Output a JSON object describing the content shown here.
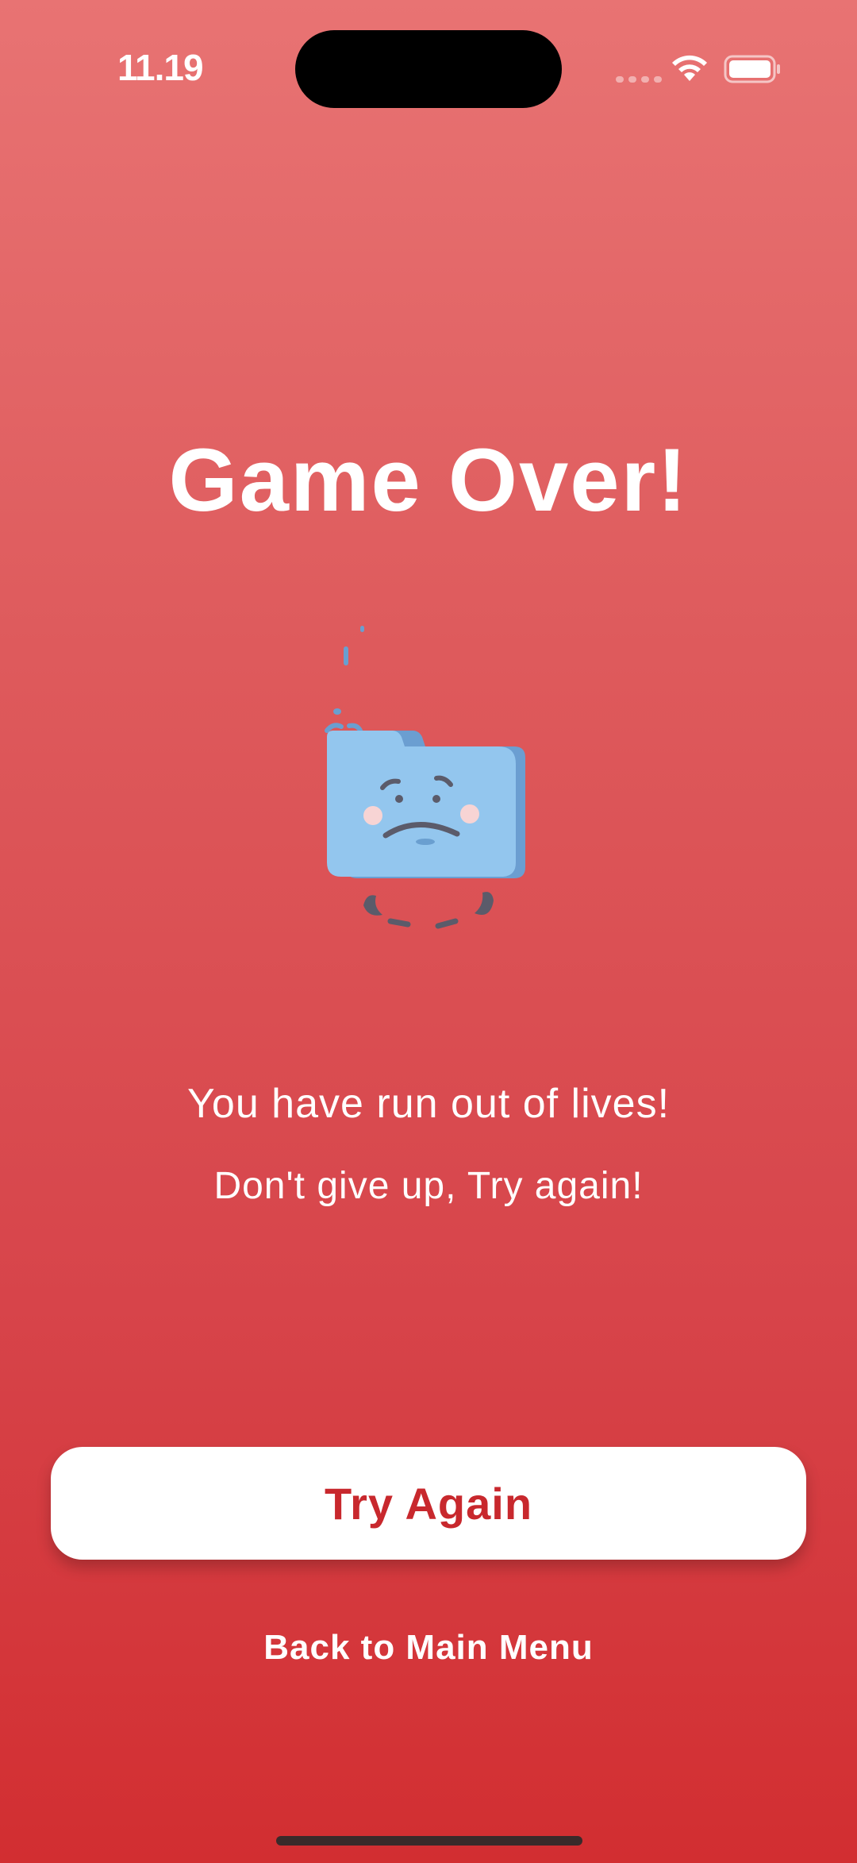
{
  "status_bar": {
    "time": "11.19",
    "icons": [
      "cellular-signal-icon",
      "wifi-icon",
      "battery-icon"
    ]
  },
  "screen": {
    "title": "Game Over!",
    "illustration": "sad-folder-icon",
    "message_primary": "You have run out of lives!",
    "message_secondary": "Don't give up, Try again!"
  },
  "actions": {
    "try_again_label": "Try Again",
    "back_to_menu_label": "Back to Main Menu"
  },
  "colors": {
    "background_top": "#e87373",
    "background_bottom": "#d22e31",
    "primary_button_text": "#c8282d",
    "primary_button_bg": "#ffffff",
    "folder_blue": "#93c6ee"
  }
}
